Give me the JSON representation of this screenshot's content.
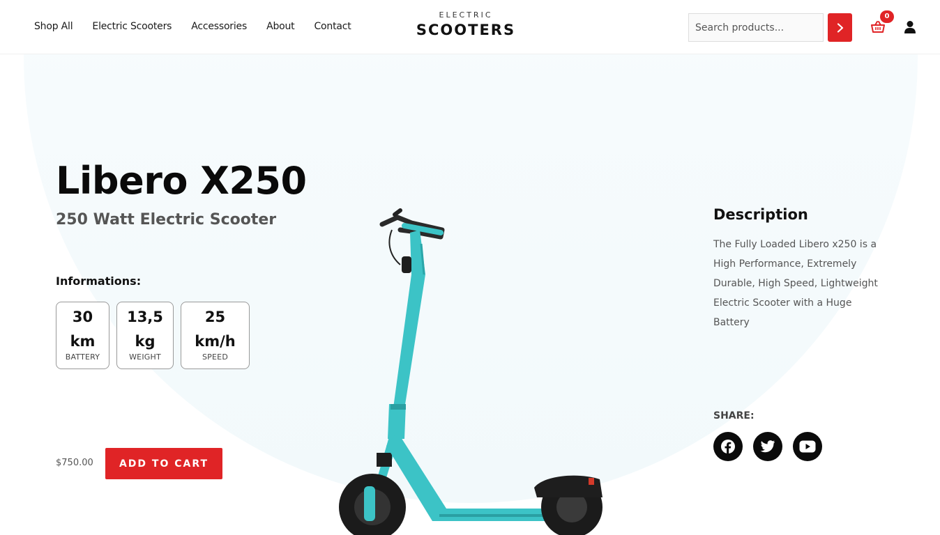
{
  "header": {
    "nav": [
      "Shop All",
      "Electric Scooters",
      "Accessories",
      "About",
      "Contact"
    ],
    "logo_top": "ELECTRIC",
    "logo_main": "SCOOTERS",
    "search_placeholder": "Search products...",
    "cart_count": "0",
    "accent_color": "#e02426"
  },
  "product": {
    "title": "Libero X250",
    "subtitle": "250 Watt Electric Scooter",
    "info_label": "Informations:",
    "specs": [
      {
        "value": "30",
        "unit": "km",
        "label": "BATTERY"
      },
      {
        "value": "13,5",
        "unit": "kg",
        "label": "WEIGHT"
      },
      {
        "value": "25",
        "unit": "km/h",
        "label": "SPEED"
      }
    ],
    "price": "$750.00",
    "add_to_cart": "ADD TO CART",
    "scooter_color": "#3cc3c6"
  },
  "description": {
    "title": "Description",
    "text": "The Fully Loaded Libero x250 is a High Performance, Extremely Durable, High Speed, Lightweight Electric Scooter with a Huge Battery"
  },
  "share": {
    "label": "SHARE:",
    "icons": [
      "facebook-icon",
      "twitter-icon",
      "youtube-icon"
    ]
  }
}
